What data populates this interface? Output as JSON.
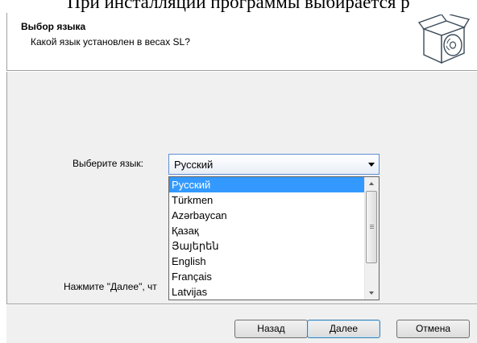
{
  "document": {
    "caption_fragment": "При инсталляции программы выбирается р"
  },
  "header": {
    "title": "Выбор языка",
    "subtitle": "Какой язык установлен в весах SL?",
    "icon": "installer-box-disc-icon"
  },
  "main": {
    "language_label": "Выберите язык:",
    "selected_language": "Русский",
    "hint": "Нажмите \"Далее\", чт",
    "dropdown_open": true,
    "languages": [
      "Русский",
      "Türkmen",
      "Azərbaycan",
      "Қазақ",
      "Յայերեն",
      "English",
      "Français",
      "Latvijas"
    ]
  },
  "footer": {
    "back_label": "Назад",
    "next_label": "Далее",
    "cancel_label": "Отмена"
  },
  "colors": {
    "selection": "#3399ff",
    "combo_border": "#5e8fd1",
    "panel_background": "#f0f0f0"
  }
}
